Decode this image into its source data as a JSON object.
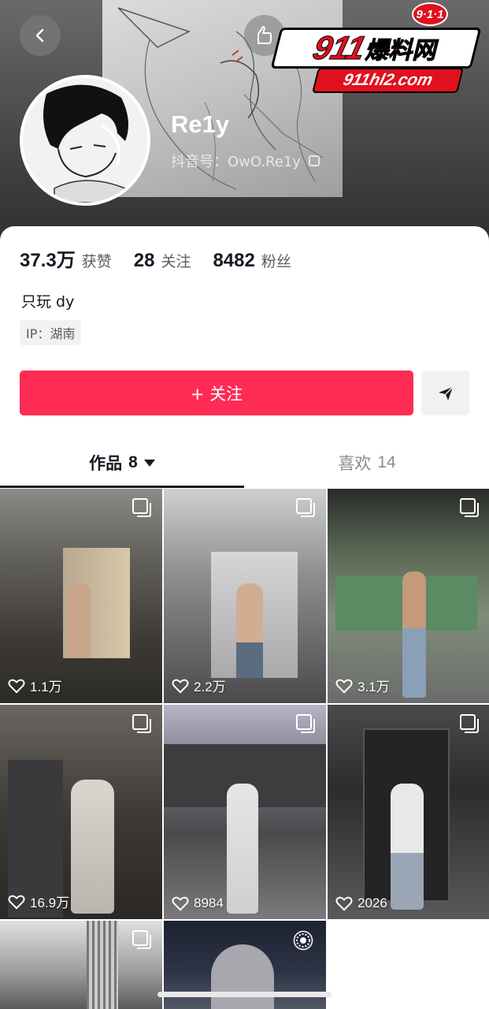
{
  "profile": {
    "username": "Re1y",
    "douyin_id": "抖音号：OwO.Re1y",
    "bio": "只玩 dy",
    "ip": "IP：湖南"
  },
  "watermark": {
    "badge": "9·1·1",
    "main_number": "911",
    "main_text": "爆料网",
    "url": "911hl2.com"
  },
  "stats": [
    {
      "value": "37.3万",
      "label": "获赞"
    },
    {
      "value": "28",
      "label": "关注"
    },
    {
      "value": "8482",
      "label": "粉丝"
    }
  ],
  "actions": {
    "follow_label": "+ 关注"
  },
  "tabs": [
    {
      "label": "作品",
      "count": "8"
    },
    {
      "label": "喜欢",
      "count": "14"
    }
  ],
  "videos": [
    {
      "likes": "1.1万",
      "type": "multi"
    },
    {
      "likes": "2.2万",
      "type": "multi"
    },
    {
      "likes": "3.1万",
      "type": "multi"
    },
    {
      "likes": "16.9万",
      "type": "multi"
    },
    {
      "likes": "8984",
      "type": "multi"
    },
    {
      "likes": "2026",
      "type": "multi"
    },
    {
      "likes": "",
      "type": "multi"
    },
    {
      "likes": "",
      "type": "live"
    }
  ],
  "icons": {
    "back": "chevron-left-icon",
    "hand": "hand-pointer-icon",
    "copy": "copy-icon",
    "share": "send-icon",
    "like": "heart-icon",
    "multi": "multi-image-icon",
    "live": "live-icon"
  },
  "colors": {
    "accent": "#fe2c55",
    "text": "#161823",
    "secondary": "#5b5c62"
  }
}
